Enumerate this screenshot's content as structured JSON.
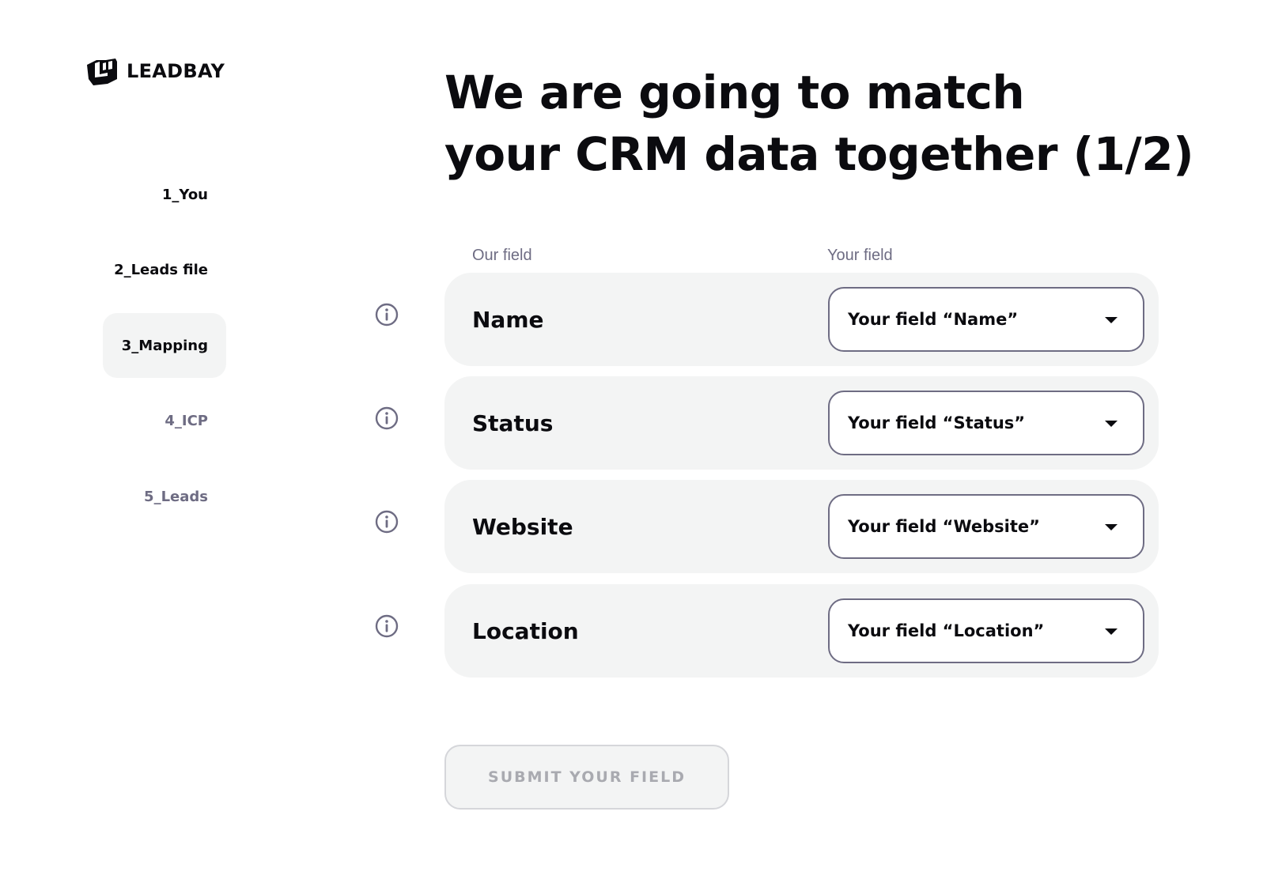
{
  "brand": {
    "name": "LEADBAY",
    "logo_icon": "leadbay-logo-icon"
  },
  "steps": [
    {
      "label": "1_You",
      "state": "done"
    },
    {
      "label": "2_Leads file",
      "state": "done"
    },
    {
      "label": "3_Mapping",
      "state": "active"
    },
    {
      "label": "4_ICP",
      "state": "todo"
    },
    {
      "label": "5_Leads",
      "state": "todo"
    }
  ],
  "title": {
    "line1": "We are going to match",
    "line2": "your CRM data together (1/2)"
  },
  "columns": {
    "ours": "Our field",
    "yours": "Your field"
  },
  "rows": [
    {
      "field": "Name",
      "selected": "Your field “Name”",
      "info_icon": "info-icon"
    },
    {
      "field": "Status",
      "selected": "Your field “Status”",
      "info_icon": "info-icon"
    },
    {
      "field": "Website",
      "selected": "Your field “Website”",
      "info_icon": "info-icon"
    },
    {
      "field": "Location",
      "selected": "Your field “Location”",
      "info_icon": "info-icon"
    }
  ],
  "submit": {
    "label": "SUBMIT YOUR FIELD",
    "disabled": true
  },
  "colors": {
    "text": "#0b0b0f",
    "muted": "#6e6c83",
    "surface": "#f3f4f4",
    "disabled_text": "#a9aab0"
  }
}
